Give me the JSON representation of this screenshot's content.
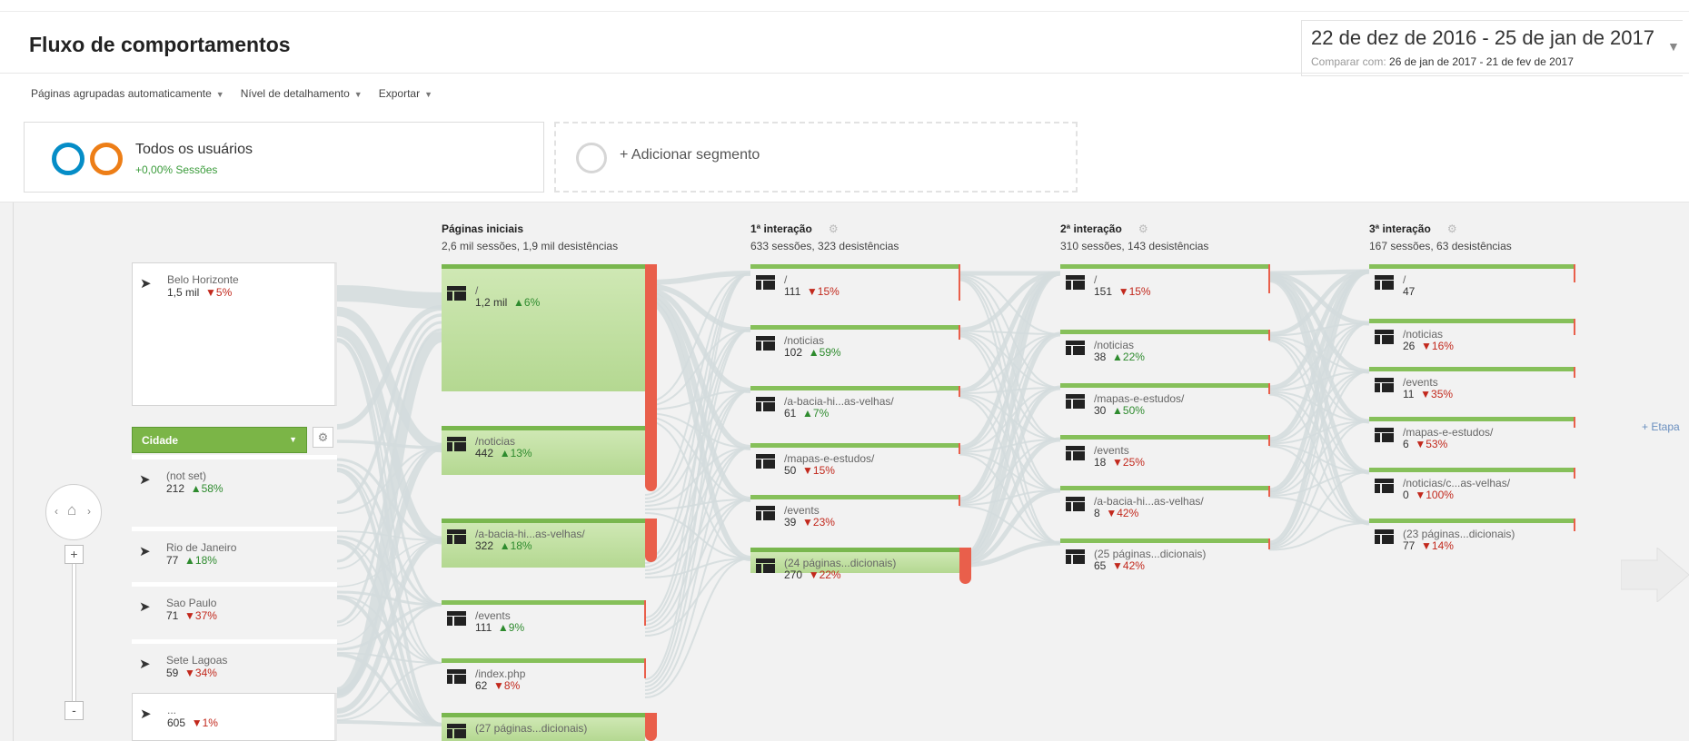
{
  "header": {
    "title": "Fluxo de comportamentos",
    "date_range": "22 de dez de 2016 - 25 de jan de 2017",
    "compare_label": "Comparar com:",
    "compare_range": "26 de jan de 2017 - 21 de fev de 2017"
  },
  "toolbar": {
    "grouping": "Páginas agrupadas automaticamente",
    "detail": "Nível de detalhamento",
    "export": "Exportar"
  },
  "segments": {
    "active_name": "Todos os usuários",
    "active_sub": "+0,00% Sessões",
    "add_label": "+ Adicionar segmento"
  },
  "dimension": {
    "label": "Cidade"
  },
  "columns": [
    {
      "title": "Páginas iniciais",
      "sub": "2,6 mil sessões, 1,9 mil desistências"
    },
    {
      "title": "1ª interação",
      "sub": "633 sessões, 323 desistências"
    },
    {
      "title": "2ª interação",
      "sub": "310 sessões, 143 desistências"
    },
    {
      "title": "3ª interação",
      "sub": "167 sessões, 63 desistências"
    }
  ],
  "cities": [
    {
      "name": "Belo Horizonte",
      "value": "1,5 mil",
      "change": "▼5%",
      "trend": "down"
    },
    {
      "name": "(not set)",
      "value": "212",
      "change": "▲58%",
      "trend": "up"
    },
    {
      "name": "Rio de Janeiro",
      "value": "77",
      "change": "▲18%",
      "trend": "up"
    },
    {
      "name": "Sao Paulo",
      "value": "71",
      "change": "▼37%",
      "trend": "down"
    },
    {
      "name": "Sete Lagoas",
      "value": "59",
      "change": "▼34%",
      "trend": "down"
    },
    {
      "name": "...",
      "value": "605",
      "change": "▼1%",
      "trend": "down"
    }
  ],
  "start_pages": [
    {
      "path": "/",
      "value": "1,2 mil",
      "change": "▲6%",
      "trend": "up"
    },
    {
      "path": "/noticias",
      "value": "442",
      "change": "▲13%",
      "trend": "up"
    },
    {
      "path": "/a-bacia-hi...as-velhas/",
      "value": "322",
      "change": "▲18%",
      "trend": "up"
    },
    {
      "path": "/events",
      "value": "111",
      "change": "▲9%",
      "trend": "up"
    },
    {
      "path": "/index.php",
      "value": "62",
      "change": "▼8%",
      "trend": "down"
    },
    {
      "path": "(27 páginas...dicionais)",
      "value": "",
      "change": "",
      "trend": "up"
    }
  ],
  "interaction1": [
    {
      "path": "/",
      "value": "111",
      "change": "▼15%",
      "trend": "down"
    },
    {
      "path": "/noticias",
      "value": "102",
      "change": "▲59%",
      "trend": "up"
    },
    {
      "path": "/a-bacia-hi...as-velhas/",
      "value": "61",
      "change": "▲7%",
      "trend": "up"
    },
    {
      "path": "/mapas-e-estudos/",
      "value": "50",
      "change": "▼15%",
      "trend": "down"
    },
    {
      "path": "/events",
      "value": "39",
      "change": "▼23%",
      "trend": "down"
    },
    {
      "path": "(24 páginas...dicionais)",
      "value": "270",
      "change": "▼22%",
      "trend": "down"
    }
  ],
  "interaction2": [
    {
      "path": "/",
      "value": "151",
      "change": "▼15%",
      "trend": "down"
    },
    {
      "path": "/noticias",
      "value": "38",
      "change": "▲22%",
      "trend": "up"
    },
    {
      "path": "/mapas-e-estudos/",
      "value": "30",
      "change": "▲50%",
      "trend": "up"
    },
    {
      "path": "/events",
      "value": "18",
      "change": "▼25%",
      "trend": "down"
    },
    {
      "path": "/a-bacia-hi...as-velhas/",
      "value": "8",
      "change": "▼42%",
      "trend": "down"
    },
    {
      "path": "(25 páginas...dicionais)",
      "value": "65",
      "change": "▼42%",
      "trend": "down"
    }
  ],
  "interaction3": [
    {
      "path": "/",
      "value": "47",
      "change": "",
      "trend": "up"
    },
    {
      "path": "/noticias",
      "value": "26",
      "change": "▼16%",
      "trend": "down"
    },
    {
      "path": "/events",
      "value": "11",
      "change": "▼35%",
      "trend": "down"
    },
    {
      "path": "/mapas-e-estudos/",
      "value": "6",
      "change": "▼53%",
      "trend": "down"
    },
    {
      "path": "/noticias/c...as-velhas/",
      "value": "0",
      "change": "▼100%",
      "trend": "down"
    },
    {
      "path": "(23 páginas...dicionais)",
      "value": "77",
      "change": "▼14%",
      "trend": "down"
    }
  ],
  "next_step_label": "+ Etapa",
  "colors": {
    "node_green": "#b4d891",
    "node_green_top": "#79b74e",
    "dropoff_red": "#e95f4b",
    "flow": "#d6dee0",
    "up": "#2e8b2e",
    "down": "#c2281c"
  },
  "icons": {
    "city": "arrow-entry-icon",
    "page": "page-icon",
    "home": "home-icon",
    "settings": "gear-icon"
  }
}
